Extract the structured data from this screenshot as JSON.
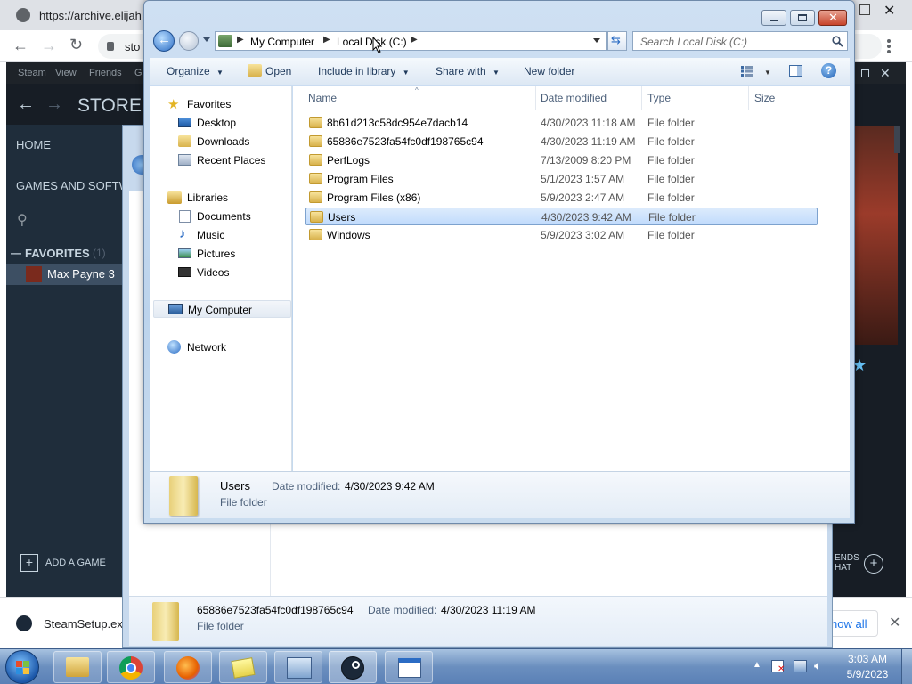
{
  "browser": {
    "tab_url": "https://archive.elijah",
    "omnibox_text": "sto",
    "download_bar": {
      "file_name": "SteamSetup.exe",
      "show_all": "how all"
    }
  },
  "steam": {
    "menu": [
      "Steam",
      "View",
      "Friends",
      "G"
    ],
    "store_label": "STORE",
    "home_label": "HOME",
    "games_label": "GAMES AND SOFTW",
    "favorites_label": "FAVORITES",
    "favorites_count": "(1)",
    "game_name": "Max Payne 3",
    "add_game_label": "ADD A GAME",
    "friends_label_1": "ENDS",
    "friends_label_2": "HAT"
  },
  "back_dialog": {
    "details_name": "65886e7523fa54fc0df198765c94",
    "details_date_label": "Date modified:",
    "details_date_value": "4/30/2023 11:19 AM",
    "details_type": "File folder"
  },
  "explorer": {
    "breadcrumb": [
      "My Computer",
      "Local Disk (C:)"
    ],
    "search_placeholder": "Search Local Disk (C:)",
    "toolbar": {
      "organize": "Organize",
      "open": "Open",
      "include_in_library": "Include in library",
      "share_with": "Share with",
      "new_folder": "New folder"
    },
    "nav": {
      "favorites": "Favorites",
      "favorites_items": [
        "Desktop",
        "Downloads",
        "Recent Places"
      ],
      "libraries": "Libraries",
      "libraries_items": [
        "Documents",
        "Music",
        "Pictures",
        "Videos"
      ],
      "computer": "My Computer",
      "network": "Network"
    },
    "columns": [
      "Name",
      "Date modified",
      "Type",
      "Size"
    ],
    "files": [
      {
        "name": "8b61d213c58dc954e7dacb14",
        "date": "4/30/2023 11:18 AM",
        "type": "File folder"
      },
      {
        "name": "65886e7523fa54fc0df198765c94",
        "date": "4/30/2023 11:19 AM",
        "type": "File folder"
      },
      {
        "name": "PerfLogs",
        "date": "7/13/2009 8:20 PM",
        "type": "File folder"
      },
      {
        "name": "Program Files",
        "date": "5/1/2023 1:57 AM",
        "type": "File folder"
      },
      {
        "name": "Program Files (x86)",
        "date": "5/9/2023 2:47 AM",
        "type": "File folder"
      },
      {
        "name": "Users",
        "date": "4/30/2023 9:42 AM",
        "type": "File folder"
      },
      {
        "name": "Windows",
        "date": "5/9/2023 3:02 AM",
        "type": "File folder"
      }
    ],
    "selected_index": 5,
    "details": {
      "name": "Users",
      "date_label": "Date modified:",
      "date_value": "4/30/2023 9:42 AM",
      "type": "File folder"
    }
  },
  "taskbar": {
    "time": "3:03 AM",
    "date": "5/9/2023"
  },
  "colors": {
    "selection": "#cde3fc",
    "steam_bg": "#1b2838",
    "explorer_frame": "#bcd3ec"
  }
}
